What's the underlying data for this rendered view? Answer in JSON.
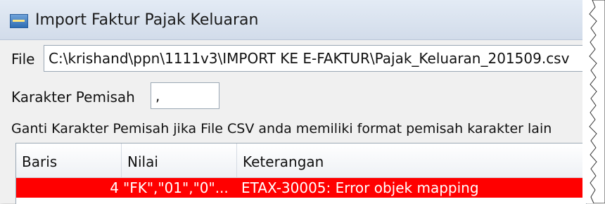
{
  "window": {
    "title": "Import Faktur Pajak Keluaran",
    "icon": "tax-app-icon"
  },
  "file": {
    "label": "File",
    "value": "C:\\krishand\\ppn\\1111v3\\IMPORT KE E-FAKTUR\\Pajak_Keluaran_201509.csv"
  },
  "separator": {
    "label": "Karakter Pemisah",
    "value": ","
  },
  "hint": "Ganti Karakter Pemisah jika File CSV anda memiliki format pemisah karakter lain",
  "table": {
    "columns": [
      "Baris",
      "Nilai",
      "Keterangan"
    ],
    "rows": [
      {
        "baris": "4",
        "nilai": "\"FK\",\"01\",\"0\"...",
        "keterangan": "ETAX-30005: Error objek mapping",
        "highlight_color": "#ff0000"
      }
    ]
  }
}
